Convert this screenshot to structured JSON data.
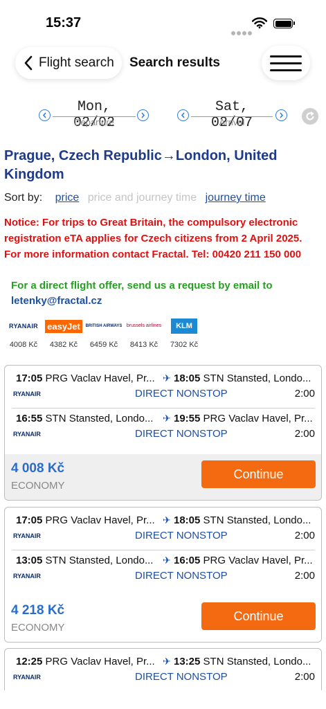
{
  "status": {
    "time": "15:37"
  },
  "nav": {
    "back_label": "Flight search",
    "title": "Search results"
  },
  "dates": {
    "departure": {
      "value": "Mon, 02/02",
      "label": "Departure"
    },
    "arrival": {
      "value": "Sat, 02/07",
      "label": "Arrival"
    }
  },
  "route_title": "Prague, Czech Republic→London, United Kingdom",
  "sort": {
    "label": "Sort by:",
    "options": [
      "price",
      "price and journey time",
      "journey time"
    ]
  },
  "notice": "Notice: For trips to Great Britain, the compulsory electronic registration eTA applies for Czech citizens from 2 April 2025. For more information contact Fractal. Tel: 00420 211 150 000",
  "direct_offer": {
    "text": "For a direct flight offer, send us a request by email to",
    "email": "letenky@fractal.cz"
  },
  "airlines": [
    {
      "name": "RYANAIR",
      "price": "4008 Kč"
    },
    {
      "name": "easyJet",
      "price": "4382 Kč"
    },
    {
      "name": "BRITISH AIRWAYS",
      "price": "6459 Kč"
    },
    {
      "name": "brussels airlines",
      "price": "8413 Kč"
    },
    {
      "name": "KLM",
      "price": "7302 Kč"
    }
  ],
  "offers": [
    {
      "segments": [
        {
          "dep_time": "17:05",
          "dep_airport": "PRG Vaclav Havel, Pr...",
          "arr_time": "18:05",
          "arr_airport": "STN Stansted, Londo...",
          "airline": "RYANAIR",
          "type": "DIRECT NONSTOP",
          "duration": "2:00"
        },
        {
          "dep_time": "16:55",
          "dep_airport": "STN Stansted, Londo...",
          "arr_time": "19:55",
          "arr_airport": "PRG Vaclav Havel, Pr...",
          "airline": "RYANAIR",
          "type": "DIRECT NONSTOP",
          "duration": "2:00"
        }
      ],
      "price": "4 008 Kč",
      "cabin": "ECONOMY",
      "button": "Continue"
    },
    {
      "segments": [
        {
          "dep_time": "17:05",
          "dep_airport": "PRG Vaclav Havel, Pr...",
          "arr_time": "18:05",
          "arr_airport": "STN Stansted, Londo...",
          "airline": "RYANAIR",
          "type": "DIRECT NONSTOP",
          "duration": "2:00"
        },
        {
          "dep_time": "13:05",
          "dep_airport": "STN Stansted, Londo...",
          "arr_time": "16:05",
          "arr_airport": "PRG Vaclav Havel, Pr...",
          "airline": "RYANAIR",
          "type": "DIRECT NONSTOP",
          "duration": "2:00"
        }
      ],
      "price": "4 218 Kč",
      "cabin": "ECONOMY",
      "button": "Continue"
    },
    {
      "segments": [
        {
          "dep_time": "12:25",
          "dep_airport": "PRG Vaclav Havel, Pr...",
          "arr_time": "13:25",
          "arr_airport": "STN Stansted, Londo...",
          "airline": "RYANAIR",
          "type": "DIRECT NONSTOP",
          "duration": "2:00"
        }
      ]
    }
  ],
  "colors": {
    "accent_blue": "#1e4fa0",
    "notice_red": "#e01010",
    "offer_green": "#23a11f",
    "button_orange": "#f36a10",
    "price_blue": "#2a6dc9"
  }
}
